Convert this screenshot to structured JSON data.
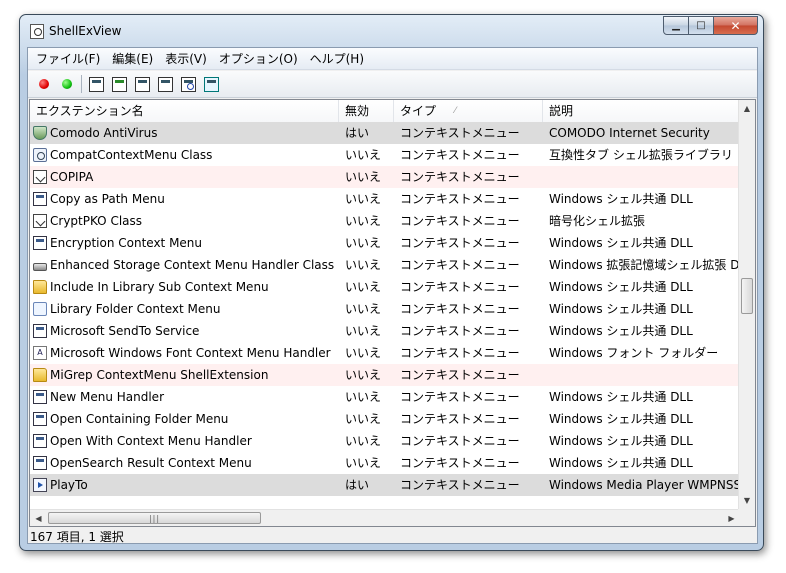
{
  "window": {
    "title": "ShellExView"
  },
  "menu": [
    "ファイル(F)",
    "編集(E)",
    "表示(V)",
    "オプション(O)",
    "ヘルプ(H)"
  ],
  "toolbar": {
    "icons": [
      "disable-red-icon",
      "enable-green-icon",
      "save-icon",
      "refresh-icon",
      "copy-icon",
      "properties-icon",
      "find-icon",
      "exit-icon"
    ]
  },
  "table": {
    "columns": [
      "エクステンション名",
      "無効",
      "タイプ",
      "説明"
    ],
    "rows": [
      {
        "name": "Comodo AntiVirus",
        "disabled": "はい",
        "type": "コンテキストメニュー",
        "desc": "COMODO Internet Security",
        "icon": "shield-icon",
        "style": "gray"
      },
      {
        "name": "CompatContextMenu Class",
        "disabled": "いいえ",
        "type": "コンテキストメニュー",
        "desc": "互換性タブ シェル拡張ライブラリ",
        "icon": "gear-icon",
        "style": ""
      },
      {
        "name": "COPIPA",
        "disabled": "いいえ",
        "type": "コンテキストメニュー",
        "desc": "",
        "icon": "note-icon",
        "style": "pink"
      },
      {
        "name": "Copy as Path Menu",
        "disabled": "いいえ",
        "type": "コンテキストメニュー",
        "desc": "Windows シェル共通 DLL",
        "icon": "document-icon",
        "style": ""
      },
      {
        "name": "CryptPKO Class",
        "disabled": "いいえ",
        "type": "コンテキストメニュー",
        "desc": "暗号化シェル拡張",
        "icon": "note-icon",
        "style": ""
      },
      {
        "name": "Encryption Context Menu",
        "disabled": "いいえ",
        "type": "コンテキストメニュー",
        "desc": "Windows シェル共通 DLL",
        "icon": "document-icon",
        "style": ""
      },
      {
        "name": "Enhanced Storage Context Menu Handler Class",
        "disabled": "いいえ",
        "type": "コンテキストメニュー",
        "desc": "Windows 拡張記憶域シェル拡張 DLL",
        "icon": "drive-icon",
        "style": ""
      },
      {
        "name": "Include In Library Sub Context Menu",
        "disabled": "いいえ",
        "type": "コンテキストメニュー",
        "desc": "Windows シェル共通 DLL",
        "icon": "folder-icon",
        "style": ""
      },
      {
        "name": "Library Folder Context Menu",
        "disabled": "いいえ",
        "type": "コンテキストメニュー",
        "desc": "Windows シェル共通 DLL",
        "icon": "library-icon",
        "style": ""
      },
      {
        "name": "Microsoft SendTo Service",
        "disabled": "いいえ",
        "type": "コンテキストメニュー",
        "desc": "Windows シェル共通 DLL",
        "icon": "document-icon",
        "style": ""
      },
      {
        "name": "Microsoft Windows Font Context Menu Handler",
        "disabled": "いいえ",
        "type": "コンテキストメニュー",
        "desc": "Windows フォント フォルダー",
        "icon": "font-icon",
        "style": ""
      },
      {
        "name": "MiGrep ContextMenu ShellExtension",
        "disabled": "いいえ",
        "type": "コンテキストメニュー",
        "desc": "",
        "icon": "folder-icon",
        "style": "pink"
      },
      {
        "name": "New Menu Handler",
        "disabled": "いいえ",
        "type": "コンテキストメニュー",
        "desc": "Windows シェル共通 DLL",
        "icon": "document-icon",
        "style": ""
      },
      {
        "name": "Open Containing Folder Menu",
        "disabled": "いいえ",
        "type": "コンテキストメニュー",
        "desc": "Windows シェル共通 DLL",
        "icon": "document-icon",
        "style": ""
      },
      {
        "name": "Open With Context Menu Handler",
        "disabled": "いいえ",
        "type": "コンテキストメニュー",
        "desc": "Windows シェル共通 DLL",
        "icon": "document-icon",
        "style": ""
      },
      {
        "name": "OpenSearch Result Context Menu",
        "disabled": "いいえ",
        "type": "コンテキストメニュー",
        "desc": "Windows シェル共通 DLL",
        "icon": "document-icon",
        "style": ""
      },
      {
        "name": "PlayTo",
        "disabled": "はい",
        "type": "コンテキストメニュー",
        "desc": "Windows Media Player WMPNSS",
        "icon": "play-icon",
        "style": "gray"
      }
    ]
  },
  "status": {
    "text": "167 項目, 1 選択"
  }
}
